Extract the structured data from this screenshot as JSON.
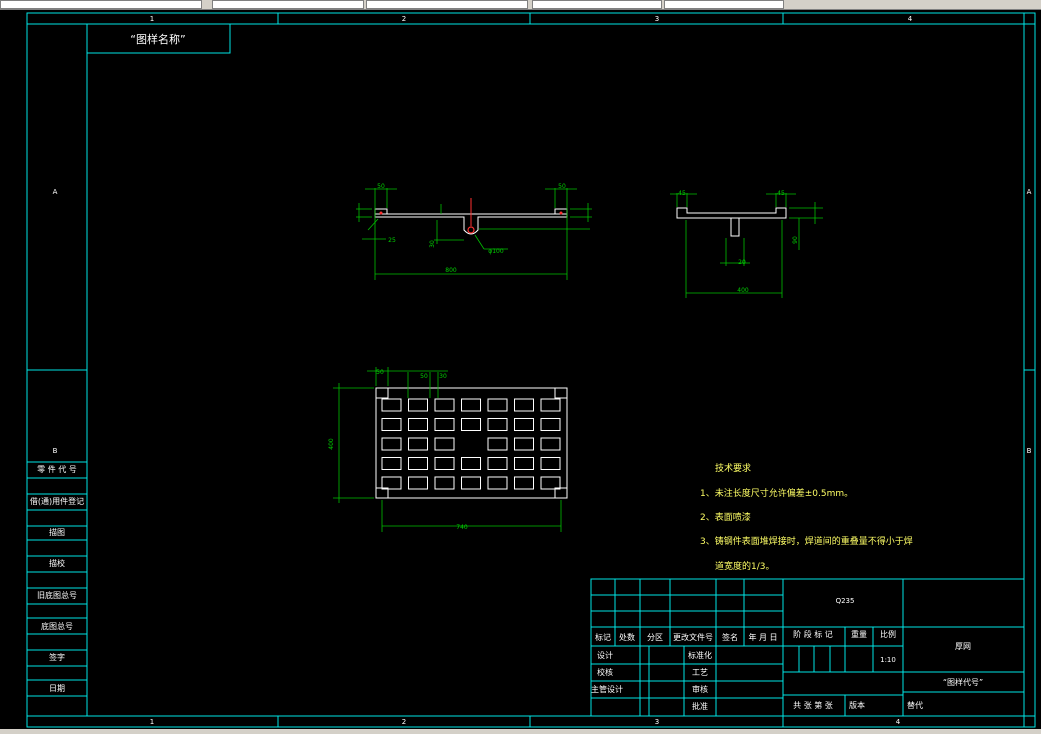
{
  "drawing": {
    "title_box": "“图样名称”",
    "zone_cols": [
      "1",
      "2",
      "3",
      "4"
    ],
    "zone_rows": [
      "A",
      "B"
    ],
    "left_strip": [
      "零 件 代 号",
      "借(通)用件登记",
      "描图",
      "描校",
      "旧底图总号",
      "底图总号",
      "签字",
      "日期"
    ],
    "dims": {
      "front_left_top": "50",
      "front_right_top": "50",
      "front_width": "800",
      "front_bolt": "φ100",
      "front_left_small": "25",
      "front_mid": "30",
      "side_left_top": "45",
      "side_right_top": "45",
      "side_mid": "20",
      "side_width": "400",
      "side_vert": "90",
      "plan_top_a": "50",
      "plan_top_b": "50",
      "plan_top_c": "30",
      "plan_height": "400",
      "plan_width": "740"
    },
    "tech": {
      "heading": "技术要求",
      "line1": "1、未注长度尺寸允许偏差±0.5mm。",
      "line2": "2、表面喷漆",
      "line3": "3、铸钢件表面堆焊接时，焊道间的重叠量不得小于焊",
      "line4": "道宽度的1/3。"
    },
    "title_block": {
      "material": "Q235",
      "name": "厚网",
      "code": "“图样代号”",
      "h_mark": "标记",
      "h_count": "处数",
      "h_zone": "分区",
      "h_doc": "更改文件号",
      "h_sign": "签名",
      "h_date": "年 月 日",
      "h_stage": "阶 段 标 记",
      "h_weight": "重量",
      "h_scale": "比例",
      "scale": "1:10",
      "r_design": "设计",
      "r_std": "标准化",
      "r_check": "校核",
      "r_proc": "工艺",
      "r_mgr": "主管设计",
      "r_review": "审核",
      "r_approve": "批准",
      "sheets": "共  张  第  张",
      "version": "版本",
      "replace": "替代"
    }
  }
}
